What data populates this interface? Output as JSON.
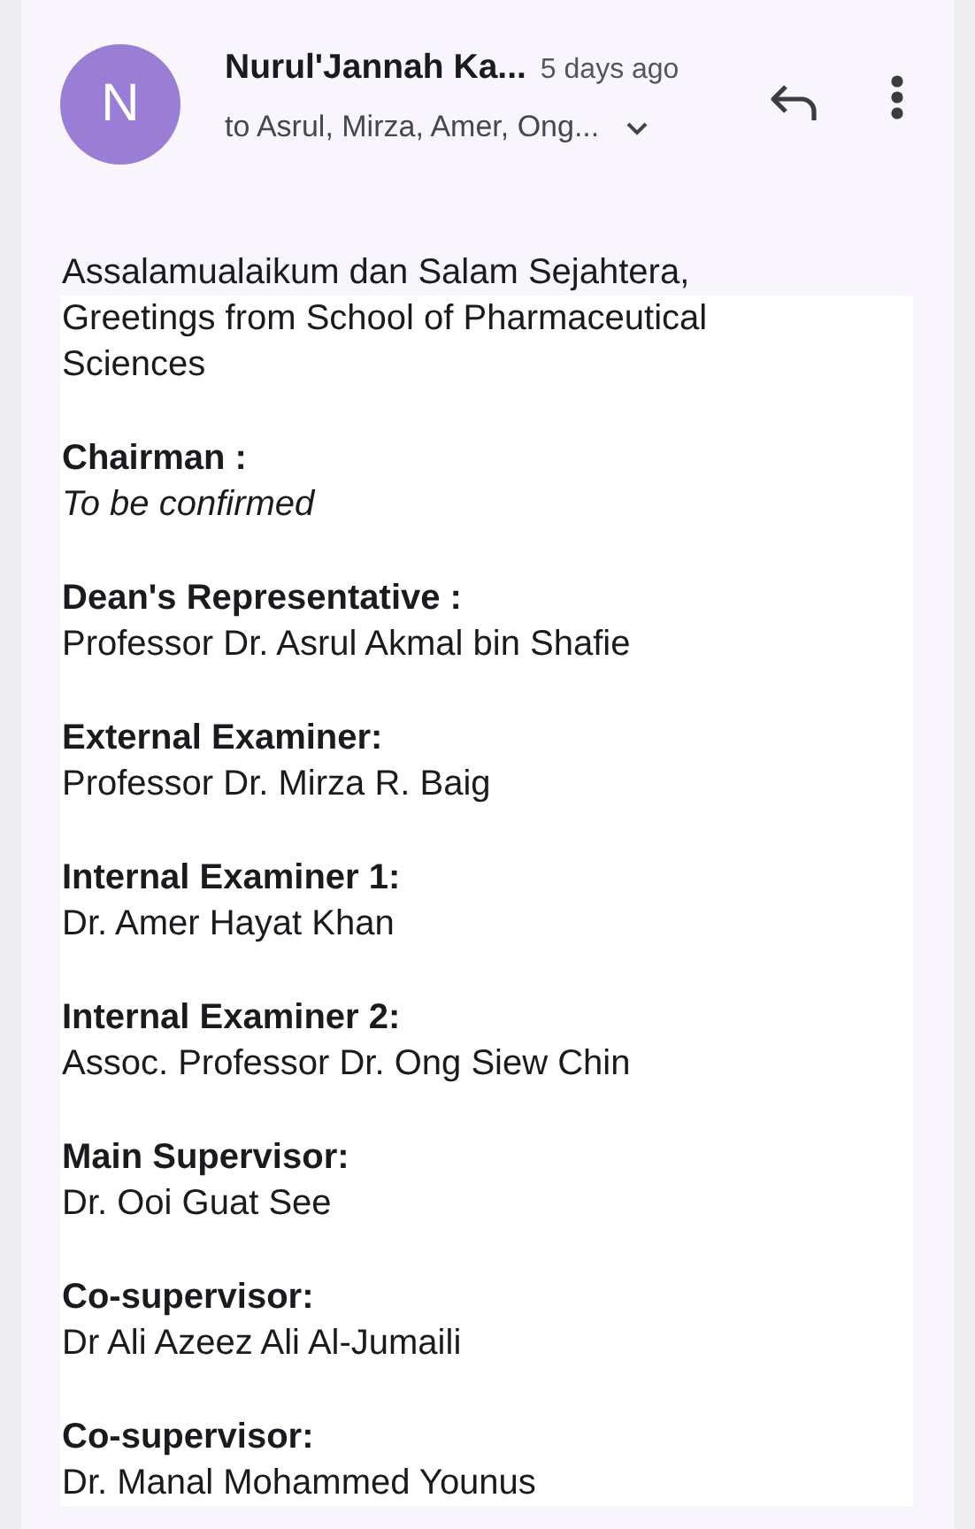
{
  "message": {
    "avatar_letter": "N",
    "sender": "Nurul'Jannah Ka...",
    "time": "5 days ago",
    "recipients": "to Asrul, Mirza, Amer, Ong...",
    "greeting": "Assalamualaikum dan Salam Sejahtera,",
    "intro": "Greetings from School of Pharmaceutical Sciences",
    "sections": [
      {
        "label": "Chairman :",
        "value": "To be confirmed",
        "kind": "italic"
      },
      {
        "label": "Dean's Representative :",
        "value": "Professor Dr. Asrul Akmal bin Shafie",
        "kind": "plain"
      },
      {
        "label": "External Examiner:",
        "value": "Professor Dr. Mirza R. Baig",
        "kind": "plain"
      },
      {
        "label": "Internal Examiner 1:",
        "value": "Dr. Amer Hayat Khan",
        "kind": "plain"
      },
      {
        "label": "Internal Examiner 2:",
        "value": "Assoc. Professor Dr. Ong Siew Chin",
        "kind": "plain"
      },
      {
        "label": "Main Supervisor:",
        "value": "Dr. Ooi Guat See",
        "kind": "plain"
      },
      {
        "label": "Co-supervisor:",
        "value": "Dr Ali Azeez Ali Al-Jumaili",
        "kind": "plain"
      },
      {
        "label": "Co-supervisor:",
        "value": "Dr. Manal Mohammed Younus",
        "kind": "plain"
      }
    ]
  }
}
